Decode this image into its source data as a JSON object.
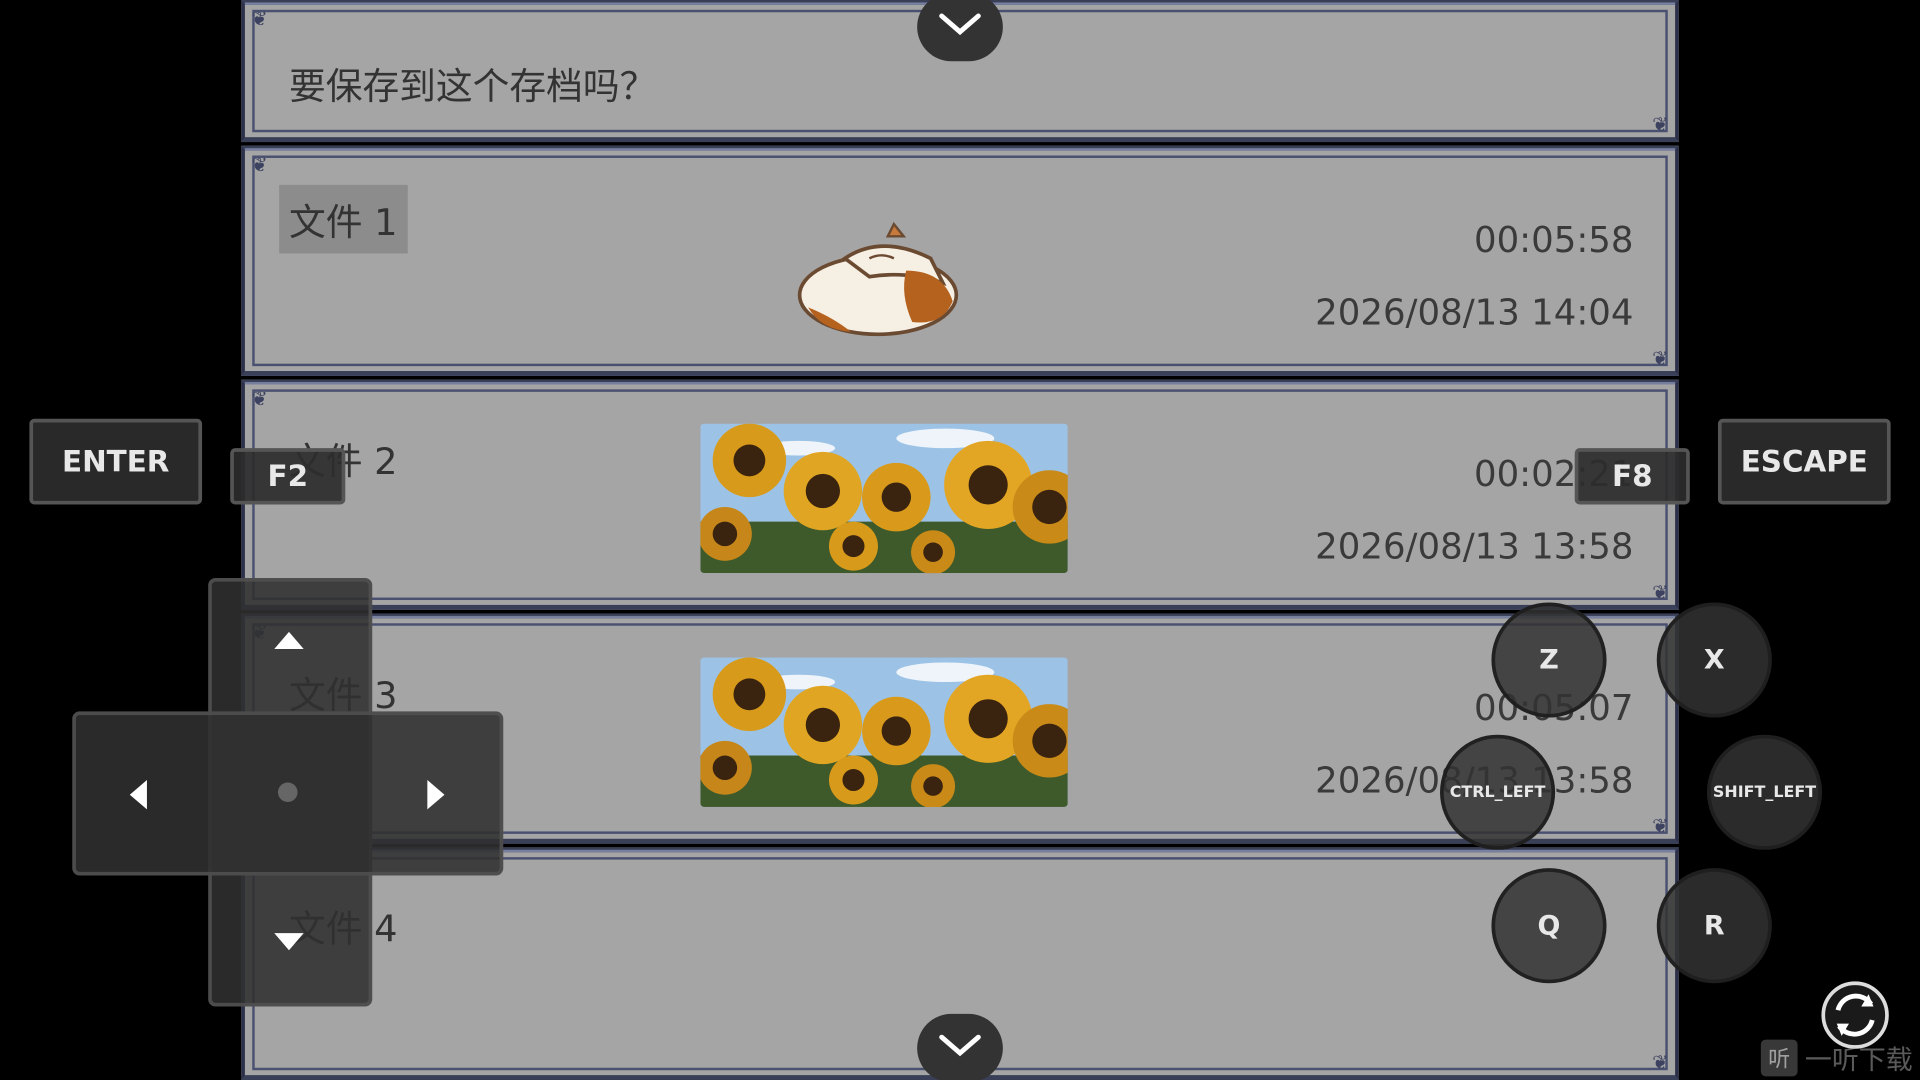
{
  "help": {
    "text": "要保存到这个存档吗？"
  },
  "slots": [
    {
      "label": "文件 1",
      "playtime": "00:05:58",
      "datetime": "2026/08/13 14:04",
      "thumbnail": "cat-sprite",
      "selected": true
    },
    {
      "label": "文件 2",
      "playtime": "00:02:21",
      "datetime": "2026/08/13 13:58",
      "thumbnail": "sunflowers",
      "selected": false
    },
    {
      "label": "文件 3",
      "playtime": "00:05:07",
      "datetime": "2026/08/13 13:58",
      "thumbnail": "sunflowers",
      "selected": false
    },
    {
      "label": "文件 4",
      "playtime": "",
      "datetime": "",
      "thumbnail": "",
      "selected": false
    }
  ],
  "controls": {
    "enter": "ENTER",
    "escape": "ESCAPE",
    "f2": "F2",
    "f8": "F8",
    "z": "Z",
    "x": "X",
    "ctrl_left": "CTRL_LEFT",
    "shift_left": "SHIFT_LEFT",
    "q": "Q",
    "r": "R"
  },
  "icons": {
    "scroll_up": "chevron-down-icon",
    "scroll_down": "chevron-down-icon",
    "refresh": "refresh-icon"
  },
  "watermark": {
    "badge": "听",
    "text": "一听下载"
  },
  "colors": {
    "panel": "#a5a5a5",
    "frame": "#3a3f58",
    "selected_highlight": "#8c8c8c",
    "overlay_button": "#2d2d2d"
  }
}
